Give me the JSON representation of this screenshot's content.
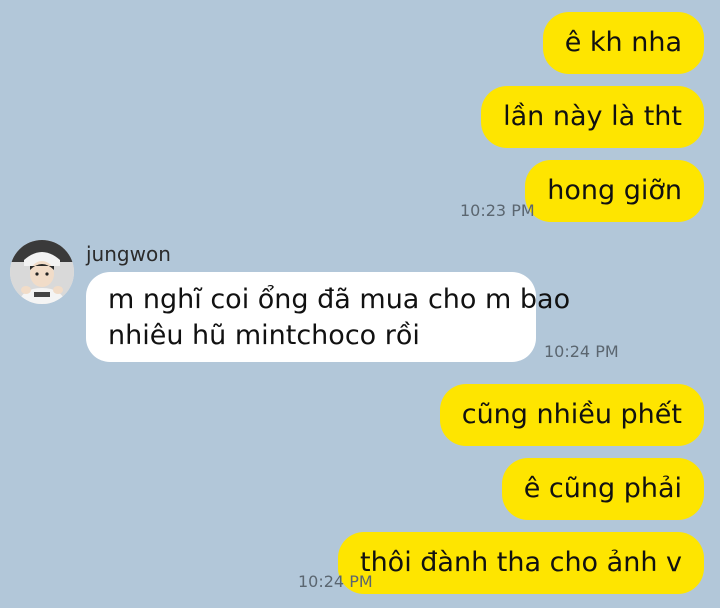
{
  "chat": {
    "group1": {
      "messages": [
        "ê kh nha",
        "lần này là tht",
        "hong giỡn"
      ],
      "time": "10:23 PM"
    },
    "incoming": {
      "sender": "jungwon",
      "line1": "m nghĩ coi ổng đã mua cho m bao",
      "line2": "nhiêu hũ mintchoco rồi",
      "time": "10:24 PM"
    },
    "group2": {
      "messages": [
        "cũng nhiều phết",
        "ê cũng phải",
        "thôi đành tha cho ảnh v"
      ],
      "time": "10:24 PM"
    }
  },
  "colors": {
    "background": "#b2c7d9",
    "outgoing_bubble": "#fee500",
    "incoming_bubble": "#ffffff"
  }
}
